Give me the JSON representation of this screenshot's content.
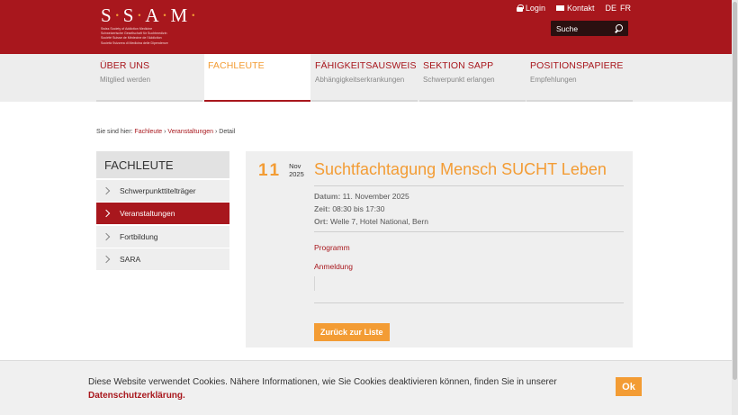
{
  "header": {
    "logo_text": "S·S·A·M·",
    "logo_lines": [
      "Swiss Society of Addiction Medicine",
      "Schweizerische Gesellschaft für Suchtmedizin",
      "Société Suisse de Médecine de l'Addiction",
      "Società Svizzera di Medicina delle Dipendenze"
    ],
    "login_label": "Login",
    "contact_label": "Kontakt",
    "lang_de": "DE",
    "lang_fr": "FR",
    "search_placeholder": "Suche"
  },
  "nav": [
    {
      "title": "ÜBER UNS",
      "sub": "Mitglied werden"
    },
    {
      "title": "FACHLEUTE",
      "sub": ""
    },
    {
      "title": "FÄHIGKEITSAUSWEIS",
      "sub": "Abhängigkeitserkrankungen"
    },
    {
      "title": "SEKTION SAPP",
      "sub": "Schwerpunkt erlangen"
    },
    {
      "title": "POSITIONSPAPIERE",
      "sub": "Empfehlungen"
    }
  ],
  "breadcrumb": {
    "prefix": "Sie sind hier:",
    "item1": "Fachleute",
    "item2": "Veranstaltungen",
    "current": "Detail",
    "sep": "›"
  },
  "sidebar": {
    "heading": "FACHLEUTE",
    "items": [
      {
        "label": "Schwerpunkttitelträger"
      },
      {
        "label": "Veranstaltungen"
      },
      {
        "label": "Fortbildung"
      },
      {
        "label": "SARA"
      }
    ]
  },
  "event": {
    "day": "11",
    "month": "Nov",
    "year": "2025",
    "title": "Suchtfachtagung Mensch SUCHT Leben",
    "date_label": "Datum:",
    "date_value": "11. November 2025",
    "time_label": "Zeit:",
    "time_value": "08:30 bis 17:30",
    "place_label": "Ort:",
    "place_value": "Welle 7, Hotel National, Bern",
    "links": [
      "Programm",
      "Anmeldung"
    ],
    "back_label": "Zurück zur Liste"
  },
  "cookie": {
    "text": "Diese Website verwendet Cookies. Nähere Informationen, wie Sie Cookies deaktivieren können, finden Sie in unserer",
    "link_label": "Datenschutzerklärung.",
    "ok_label": "Ok"
  },
  "colors": {
    "brand_red": "#a8171d",
    "accent_orange": "#f39c34"
  }
}
